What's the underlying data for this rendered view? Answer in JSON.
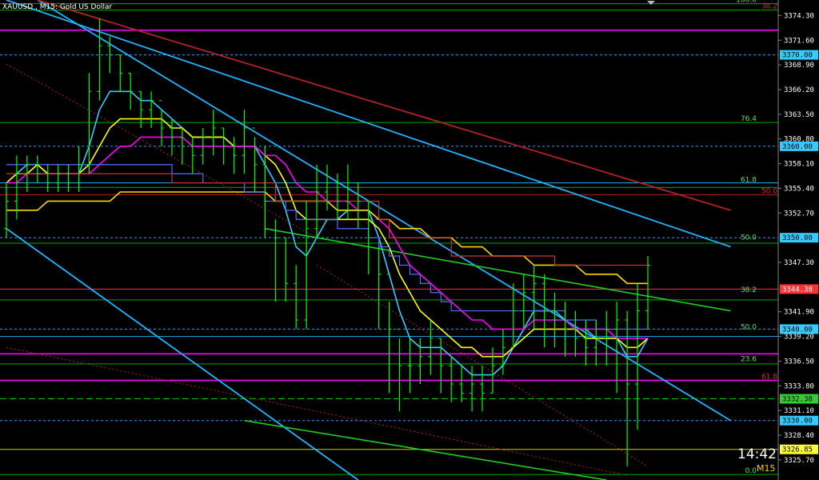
{
  "window": {
    "title": "XAUUSD , M15:  Gold US Dollar",
    "clock": "14:42",
    "timeframe": "M15"
  },
  "colors": {
    "background": "#000000",
    "bull_candle": "#00ff00",
    "ema_fast": "#33ccff",
    "ema_mid": "#ffff00",
    "ema_slow": "#ff00ff",
    "ema_long": "#ffd700",
    "ichimoku_blue": "#4f6fff",
    "ichimoku_red": "#cc3333",
    "trend_blue": "#1eb4ff",
    "trend_red": "#b22222",
    "trend_green": "#22cc22",
    "fib_line": "#00aa00",
    "level_magenta": "#ff00ff",
    "level_red": "#ff3333",
    "level_dashed_blue": "#3399ff",
    "level_green_dashed": "#00cc00",
    "level_yellow": "#cccc00"
  },
  "chart_data": {
    "type": "candlestick",
    "title": "XAUUSD , M15:  Gold US Dollar",
    "y_range": [
      3323.5,
      3376.0
    ],
    "y_ticks": [
      "3374.30",
      "3371.60",
      "3368.90",
      "3366.20",
      "3363.50",
      "3360.80",
      "3358.10",
      "3355.40",
      "3352.70",
      "3347.30",
      "3341.90",
      "3339.20",
      "3336.50",
      "3333.80",
      "3331.10",
      "3328.40",
      "3325.70"
    ],
    "price_tags": [
      {
        "label": "3370.00",
        "price": 3370.0,
        "style": "dashed-blue"
      },
      {
        "label": "3360.00",
        "price": 3360.0,
        "style": "dashed-blue"
      },
      {
        "label": "3350.00",
        "price": 3350.0,
        "style": "dashed-blue"
      },
      {
        "label": "3344.38",
        "price": 3344.38,
        "style": "red"
      },
      {
        "label": "3340.00",
        "price": 3340.0,
        "style": "dashed-blue"
      },
      {
        "label": "3332.38",
        "price": 3332.38,
        "style": "green-dashed"
      },
      {
        "label": "3330.00",
        "price": 3330.0,
        "style": "dashed-blue"
      },
      {
        "label": "3326.85",
        "price": 3326.85,
        "style": "yellow"
      }
    ],
    "fib_labels": [
      {
        "label": "100.0",
        "price": 3375.6
      },
      {
        "label": "76.4",
        "price": 3362.6
      },
      {
        "label": "61.8",
        "price": 3355.9
      },
      {
        "label": "50.0",
        "price": 3349.6
      },
      {
        "label": "38.2",
        "price": 3343.9
      },
      {
        "label": "50.0",
        "price": 3339.8
      },
      {
        "label": "23.6",
        "price": 3336.3
      },
      {
        "label": "0.0",
        "price": 3324.1
      }
    ],
    "fib_labels_red": [
      {
        "label": "38.2",
        "price": 3374.9
      },
      {
        "label": "50.0",
        "price": 3354.7
      },
      {
        "label": "61.8",
        "price": 3334.4
      }
    ],
    "horizontal_levels": [
      {
        "price": 3375.6,
        "style": "fib-green"
      },
      {
        "price": 3374.9,
        "style": "fib-green"
      },
      {
        "price": 3372.7,
        "style": "magenta"
      },
      {
        "price": 3370.0,
        "style": "dashed-blue"
      },
      {
        "price": 3362.6,
        "style": "fib-green"
      },
      {
        "price": 3360.0,
        "style": "dashed-blue"
      },
      {
        "price": 3356.0,
        "style": "blue"
      },
      {
        "price": 3355.5,
        "style": "fib-green"
      },
      {
        "price": 3354.7,
        "style": "red-dark"
      },
      {
        "price": 3350.0,
        "style": "dashed-blue"
      },
      {
        "price": 3349.4,
        "style": "fib-green"
      },
      {
        "price": 3344.38,
        "style": "red"
      },
      {
        "price": 3343.2,
        "style": "fib-green"
      },
      {
        "price": 3340.0,
        "style": "dashed-blue"
      },
      {
        "price": 3339.2,
        "style": "blue-thin"
      },
      {
        "price": 3337.3,
        "style": "magenta"
      },
      {
        "price": 3336.2,
        "style": "fib-green"
      },
      {
        "price": 3334.4,
        "style": "magenta"
      },
      {
        "price": 3332.38,
        "style": "green-dashed"
      },
      {
        "price": 3330.0,
        "style": "dashed-blue"
      },
      {
        "price": 3326.85,
        "style": "yellow"
      },
      {
        "price": 3324.1,
        "style": "fib-green"
      }
    ],
    "candles": {
      "count": 63,
      "open": [
        3351,
        3354,
        3357,
        3358,
        3357,
        3356,
        3357,
        3356,
        3358,
        3366,
        3371,
        3370,
        3368,
        3366,
        3364,
        3365,
        3362,
        3361,
        3360,
        3359,
        3361,
        3362,
        3360,
        3359,
        3362,
        3358,
        3354,
        3350,
        3345,
        3341,
        3351,
        3355,
        3356,
        3354,
        3356,
        3354,
        3352,
        3346,
        3340,
        3336,
        3336,
        3337,
        3339,
        3336,
        3334,
        3333,
        3334,
        3333,
        3336,
        3338,
        3342,
        3344,
        3345,
        3342,
        3341,
        3340,
        3339,
        3338,
        3339,
        3340,
        3341,
        3334,
        3342
      ],
      "close": [
        3354,
        3357,
        3358,
        3357,
        3356,
        3357,
        3356,
        3358,
        3366,
        3371,
        3370,
        3368,
        3366,
        3364,
        3365,
        3362,
        3361,
        3360,
        3359,
        3361,
        3362,
        3360,
        3359,
        3362,
        3358,
        3354,
        3350,
        3345,
        3341,
        3351,
        3355,
        3356,
        3354,
        3356,
        3354,
        3352,
        3346,
        3340,
        3336,
        3336,
        3337,
        3339,
        3336,
        3334,
        3333,
        3334,
        3333,
        3336,
        3338,
        3342,
        3344,
        3345,
        3342,
        3341,
        3340,
        3339,
        3338,
        3339,
        3340,
        3341,
        3334,
        3342,
        3347
      ],
      "high": [
        3356,
        3359,
        3359,
        3359,
        3358,
        3358,
        3358,
        3360,
        3368,
        3374,
        3372,
        3370,
        3368,
        3366,
        3366,
        3364,
        3363,
        3362,
        3361,
        3362,
        3364,
        3362,
        3361,
        3364,
        3361,
        3360,
        3352,
        3350,
        3347,
        3354,
        3358,
        3358,
        3357,
        3358,
        3356,
        3354,
        3349,
        3343,
        3339,
        3339,
        3339,
        3341,
        3339,
        3337,
        3336,
        3336,
        3336,
        3338,
        3340,
        3345,
        3346,
        3347,
        3346,
        3344,
        3343,
        3342,
        3341,
        3341,
        3342,
        3343,
        3342,
        3345,
        3348
      ],
      "low": [
        3350,
        3352,
        3355,
        3356,
        3355,
        3355,
        3355,
        3355,
        3357,
        3365,
        3368,
        3366,
        3364,
        3362,
        3362,
        3360,
        3359,
        3358,
        3357,
        3358,
        3359,
        3358,
        3357,
        3357,
        3355,
        3350,
        3343,
        3343,
        3340,
        3340,
        3350,
        3353,
        3352,
        3352,
        3351,
        3346,
        3340,
        3333,
        3331,
        3333,
        3334,
        3335,
        3333,
        3332,
        3332,
        3331,
        3331,
        3333,
        3335,
        3338,
        3340,
        3340,
        3338,
        3338,
        3337,
        3337,
        3336,
        3336,
        3336,
        3333,
        3325,
        3329,
        3340
      ]
    },
    "overlay_series": [
      {
        "values": [
          3356,
          3357,
          3358,
          3358,
          3357,
          3357,
          3357,
          3357,
          3360,
          3364,
          3366,
          3366,
          3366,
          3365,
          3365,
          3364,
          3363,
          3362,
          3361,
          3361,
          3361,
          3361,
          3360,
          3360,
          3360,
          3358,
          3356,
          3353,
          3349,
          3348,
          3350,
          3352,
          3352,
          3353,
          3353,
          3353,
          3350,
          3346,
          3342,
          3339,
          3338,
          3338,
          3338,
          3337,
          3336,
          3335,
          3335,
          3335,
          3336,
          3338,
          3340,
          3342,
          3342,
          3342,
          3341,
          3340,
          3340,
          3339,
          3339,
          3339,
          3337,
          3337,
          3339
        ]
      },
      {
        "values": [
          3356,
          3357,
          3357,
          3358,
          3357,
          3357,
          3357,
          3357,
          3358,
          3360,
          3362,
          3363,
          3363,
          3363,
          3363,
          3363,
          3362,
          3362,
          3361,
          3361,
          3361,
          3361,
          3360,
          3360,
          3360,
          3359,
          3358,
          3356,
          3353,
          3352,
          3352,
          3352,
          3352,
          3352,
          3352,
          3352,
          3351,
          3349,
          3346,
          3344,
          3342,
          3341,
          3340,
          3339,
          3338,
          3338,
          3337,
          3337,
          3337,
          3338,
          3339,
          3340,
          3340,
          3340,
          3340,
          3340,
          3339,
          3339,
          3339,
          3339,
          3338,
          3338,
          3339
        ]
      },
      {
        "values": [
          3356,
          3356,
          3357,
          3357,
          3357,
          3357,
          3357,
          3357,
          3357,
          3358,
          3359,
          3360,
          3360,
          3361,
          3361,
          3361,
          3361,
          3361,
          3360,
          3360,
          3360,
          3360,
          3360,
          3360,
          3360,
          3359,
          3359,
          3358,
          3356,
          3355,
          3355,
          3354,
          3354,
          3354,
          3353,
          3353,
          3352,
          3351,
          3349,
          3347,
          3346,
          3345,
          3344,
          3343,
          3342,
          3341,
          3341,
          3340,
          3340,
          3340,
          3340,
          3341,
          3341,
          3341,
          3341,
          3340,
          3340,
          3340,
          3340,
          3339,
          3339,
          3339,
          3339
        ]
      },
      {
        "values": [
          3353,
          3353,
          3353,
          3353,
          3354,
          3354,
          3354,
          3354,
          3354,
          3354,
          3354,
          3355,
          3355,
          3355,
          3355,
          3355,
          3355,
          3355,
          3355,
          3355,
          3355,
          3355,
          3355,
          3355,
          3355,
          3355,
          3354,
          3354,
          3354,
          3354,
          3354,
          3354,
          3353,
          3353,
          3353,
          3353,
          3352,
          3352,
          3351,
          3351,
          3351,
          3350,
          3350,
          3350,
          3349,
          3349,
          3349,
          3348,
          3348,
          3348,
          3348,
          3347,
          3347,
          3347,
          3347,
          3347,
          3346,
          3346,
          3346,
          3346,
          3345,
          3345,
          3345
        ]
      },
      {
        "values": [
          3358,
          3358,
          3358,
          3358,
          3358,
          3358,
          3358,
          3358,
          3358,
          3358,
          3358,
          3358,
          3358,
          3358,
          3358,
          3358,
          3357,
          3357,
          3357,
          3356,
          3356,
          3356,
          3356,
          3355,
          3355,
          3354,
          3354,
          3353,
          3352,
          3352,
          3352,
          3352,
          3351,
          3351,
          3351,
          3350,
          3349,
          3348,
          3347,
          3346,
          3345,
          3344,
          3343,
          3342,
          3342,
          3342,
          3342,
          3342,
          3342,
          3342,
          3342,
          3342,
          3342,
          3342,
          3341,
          3341,
          3341,
          3340,
          3340,
          3340,
          3340,
          3340,
          3340
        ]
      },
      {
        "values": [
          3357,
          3357,
          3357,
          3357,
          3357,
          3357,
          3357,
          3357,
          3357,
          3357,
          3357,
          3357,
          3357,
          3357,
          3357,
          3357,
          3356,
          3356,
          3356,
          3356,
          3356,
          3356,
          3356,
          3356,
          3356,
          3356,
          3354,
          3354,
          3354,
          3354,
          3354,
          3354,
          3354,
          3354,
          3354,
          3354,
          3352,
          3350,
          3350,
          3350,
          3350,
          3350,
          3350,
          3348,
          3348,
          3348,
          3348,
          3348,
          3348,
          3348,
          3348,
          3348,
          3348,
          3347,
          3347,
          3347,
          3347,
          3347,
          3347,
          3347,
          3347,
          3347,
          3347
        ]
      }
    ],
    "trendlines": [
      {
        "style": "trend-blue",
        "from": [
          0,
          3376.0
        ],
        "to": [
          70,
          3349.0
        ]
      },
      {
        "style": "trend-blue",
        "from": [
          3,
          3376.0
        ],
        "to": [
          70,
          3330.0
        ]
      },
      {
        "style": "trend-blue",
        "from": [
          0,
          3351.0
        ],
        "to": [
          34,
          3323.5
        ]
      },
      {
        "style": "trend-red",
        "from": [
          3,
          3376.0
        ],
        "to": [
          70,
          3353.0
        ]
      },
      {
        "style": "trend-red-dotted",
        "from": [
          0,
          3369.0
        ],
        "to": [
          30,
          3350.0
        ]
      },
      {
        "style": "trend-red-dotted",
        "from": [
          0,
          3338.0
        ],
        "to": [
          60,
          3324.0
        ]
      },
      {
        "style": "trend-red-dotted",
        "from": [
          30,
          3347.0
        ],
        "to": [
          62,
          3325.0
        ]
      },
      {
        "style": "trend-green",
        "from": [
          25,
          3351.0
        ],
        "to": [
          70,
          3342.0
        ]
      },
      {
        "style": "trend-green",
        "from": [
          23,
          3330.0
        ],
        "to": [
          58,
          3323.5
        ]
      }
    ]
  }
}
